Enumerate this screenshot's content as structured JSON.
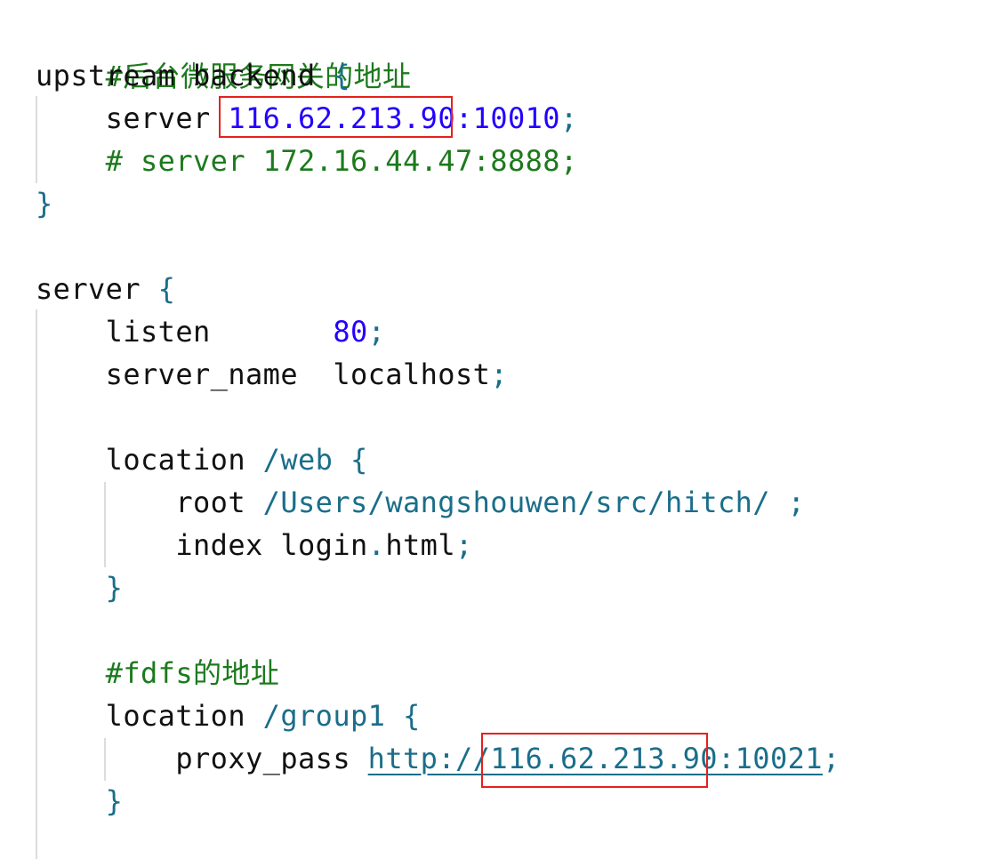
{
  "colors": {
    "comment": "#1c7a1c",
    "number": "#2200ff",
    "punctuation": "#1a6e8a",
    "highlight": "#e5211c"
  },
  "code": {
    "l1": {
      "comment": "#后台微服务网关的地址"
    },
    "l2": {
      "kw": "upstream backend ",
      "brace": "{"
    },
    "l3": {
      "kw": "    server ",
      "ip": "116.62.213.90",
      "port": ":10010",
      "semi": ";"
    },
    "l4": {
      "comment": "    # server 172.16.44.47:8888;"
    },
    "l5": {
      "brace": "}"
    },
    "l6": {
      "kw": "server ",
      "brace": "{"
    },
    "l7": {
      "kw": "    listen       ",
      "value": "80",
      "semi": ";"
    },
    "l8": {
      "kw": "    server_name  localhost",
      "semi": ";"
    },
    "l9": {
      "kw": "    location ",
      "path": "/web",
      "brace": " {"
    },
    "l10": {
      "kw": "        root ",
      "path": "/Users/wangshouwen/src/hitch/",
      "semi": " ;"
    },
    "l11": {
      "kw": "        index login",
      "dot": ".",
      "kw2": "html",
      "semi": ";"
    },
    "l12": {
      "brace": "    }"
    },
    "l13": {
      "comment": "    #fdfs的地址"
    },
    "l14": {
      "kw": "    location ",
      "path": "/group1",
      "brace": " {"
    },
    "l15": {
      "kw": "        proxy_pass ",
      "url": "http://116.62.213.90:10021",
      "semi": ";"
    },
    "l16": {
      "brace": "    }"
    }
  }
}
